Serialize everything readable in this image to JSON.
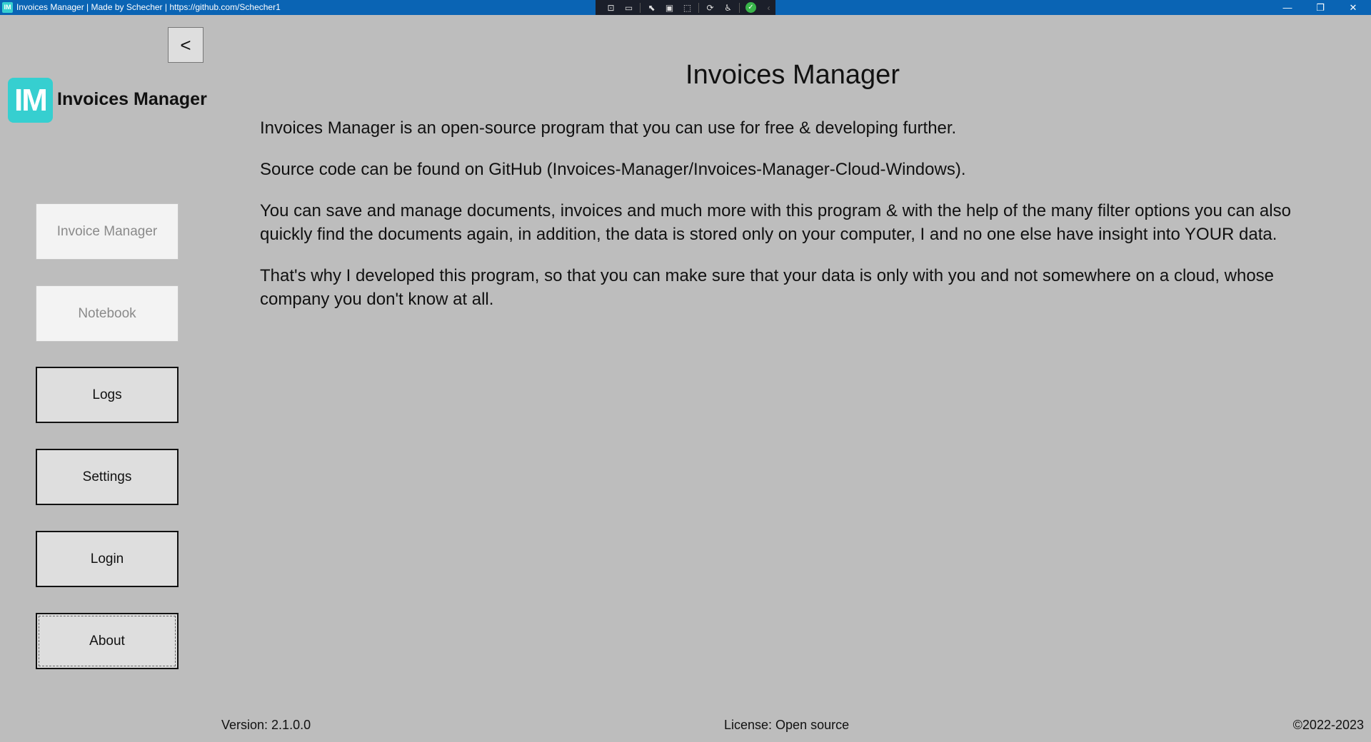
{
  "window": {
    "title": "Invoices Manager | Made by Schecher | https://github.com/Schecher1",
    "app_icon_label": "IM",
    "controls": {
      "minimize_icon": "—",
      "restore_icon": "❐",
      "close_icon": "✕"
    }
  },
  "debug_toolbar": {
    "items": [
      {
        "name": "live-visual-tree-icon",
        "glyph": "⊡"
      },
      {
        "name": "record-icon",
        "glyph": "▭"
      },
      {
        "name": "select-element-icon",
        "glyph": "⬉"
      },
      {
        "name": "display-layout-adorners-icon",
        "glyph": "▣"
      },
      {
        "name": "track-focus-icon",
        "glyph": "⬚"
      },
      {
        "name": "binding-failures-icon",
        "glyph": "⟳"
      },
      {
        "name": "accessibility-icon",
        "glyph": "♿"
      },
      {
        "name": "status-ok-icon",
        "glyph": "✓"
      },
      {
        "name": "collapse-icon",
        "glyph": "‹"
      }
    ]
  },
  "sidebar": {
    "back_label": "<",
    "logo_text": "IM",
    "brand_name": "Invoices Manager",
    "items": [
      {
        "label": "Invoice Manager",
        "enabled": false
      },
      {
        "label": "Notebook",
        "enabled": false
      },
      {
        "label": "Logs",
        "enabled": true
      },
      {
        "label": "Settings",
        "enabled": true
      },
      {
        "label": "Login",
        "enabled": true
      },
      {
        "label": "About",
        "enabled": true,
        "focused": true
      }
    ]
  },
  "main": {
    "title": "Invoices Manager",
    "paragraphs": [
      "Invoices Manager is an open-source program that you can use for free & developing further.",
      "Source code can be found on GitHub (Invoices-Manager/Invoices-Manager-Cloud-Windows).",
      "You can save and manage documents, invoices and much more with this program & with the help of the many filter options you can also quickly find the documents again, in addition, the data is stored only on your computer, I and no one else have insight into YOUR data.",
      "That's why I developed this program, so that you can make sure that your data is only with you and not somewhere on a cloud, whose company you don't know at all."
    ]
  },
  "footer": {
    "version": "Version: 2.1.0.0",
    "license": "License: Open source",
    "copyright": "©2022-2023"
  },
  "colors": {
    "titlebar": "#0a64b4",
    "background": "#bdbdbd",
    "logo": "#36cfd0"
  }
}
